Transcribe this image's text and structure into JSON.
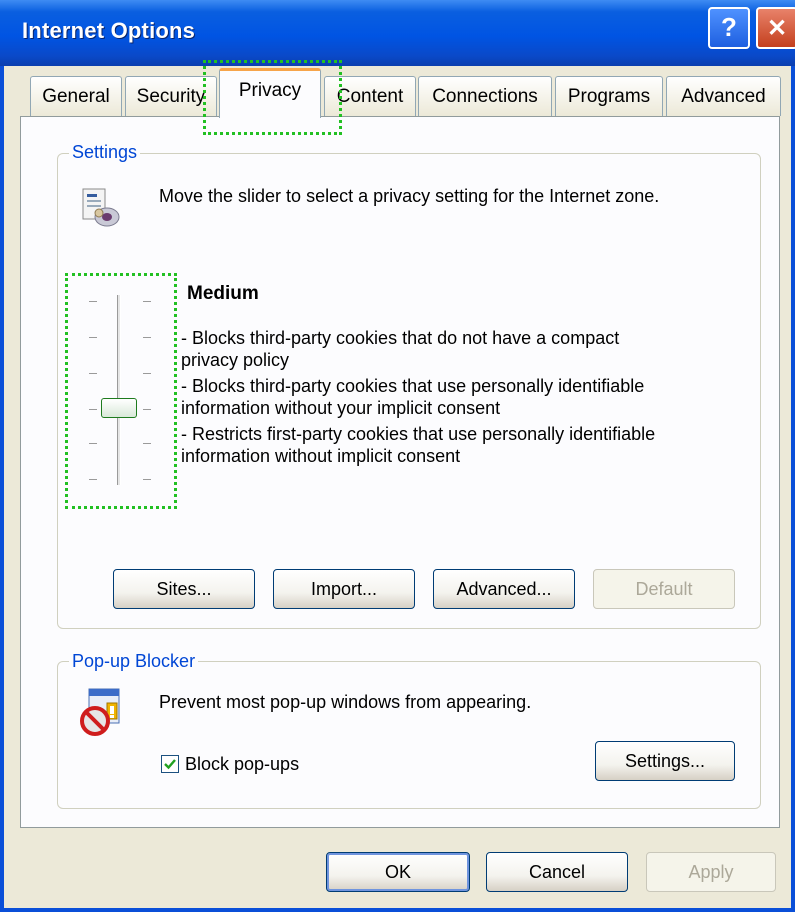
{
  "window": {
    "title": "Internet Options",
    "help_glyph": "?",
    "close_glyph": "✕"
  },
  "tabs": [
    {
      "label": "General"
    },
    {
      "label": "Security"
    },
    {
      "label": "Privacy"
    },
    {
      "label": "Content"
    },
    {
      "label": "Connections"
    },
    {
      "label": "Programs"
    },
    {
      "label": "Advanced"
    }
  ],
  "active_tab": "Privacy",
  "settings": {
    "group_label": "Settings",
    "intro": "Move the slider to select a privacy setting for the Internet zone.",
    "icon": "privacy-icon",
    "level": "Medium",
    "slider_position": "3 of 6 (from bottom)",
    "description": [
      "- Blocks third-party cookies that do not have a compact",
      "privacy policy",
      "- Blocks third-party cookies that use personally identifiable",
      "information without your implicit consent",
      "- Restricts first-party cookies that use personally identifiable",
      "information without implicit consent"
    ],
    "buttons": {
      "sites": "Sites...",
      "import": "Import...",
      "advanced": "Advanced...",
      "default": "Default"
    }
  },
  "popup": {
    "group_label": "Pop-up Blocker",
    "description": "Prevent most pop-up windows from appearing.",
    "icon": "popup-blocker-icon",
    "checkbox_label": "Block pop-ups",
    "checked": true,
    "settings_button": "Settings..."
  },
  "footer": {
    "ok": "OK",
    "cancel": "Cancel",
    "apply": "Apply"
  },
  "colors": {
    "titlebar": "#0054e3",
    "group_label": "#0046d5",
    "focus_outline": "#22c022",
    "active_tab_accent": "#f6a44a"
  }
}
